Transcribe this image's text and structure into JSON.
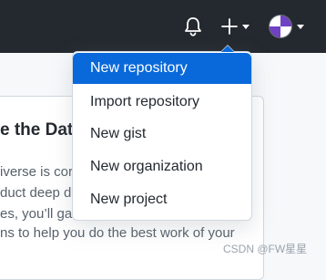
{
  "header": {
    "icons": [
      "bell-icon",
      "plus-icon",
      "avatar"
    ],
    "background_color": "#24292f"
  },
  "dropdown": {
    "items": [
      {
        "label": "New repository",
        "active": true
      },
      {
        "label": "Import repository",
        "active": false
      },
      {
        "label": "New gist",
        "active": false
      },
      {
        "label": "New organization",
        "active": false
      },
      {
        "label": "New project",
        "active": false
      }
    ],
    "highlight_color": "#0969da"
  },
  "background_card": {
    "title": "e the Dat",
    "lines": [
      "iverse is cor",
      "duct deep di",
      "es, you’ll gat",
      "ns to help you do the best work of your"
    ]
  },
  "watermark": "CSDN @FW星星"
}
